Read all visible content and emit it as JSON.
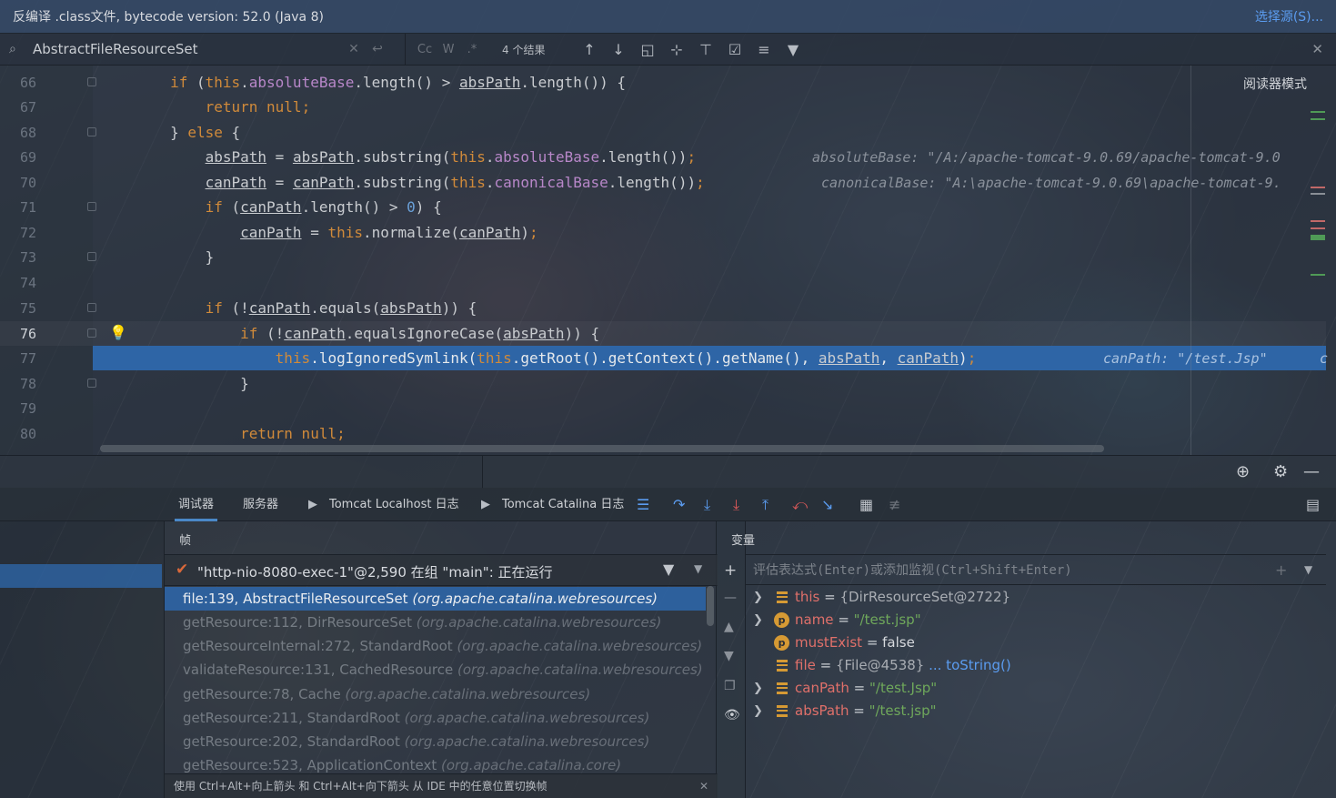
{
  "banner": {
    "text": "反编译 .class文件, bytecode version: 52.0 (Java 8)",
    "link": "选择源(S)..."
  },
  "search": {
    "query": "AbstractFileResourceSet",
    "result_count": "4 个结果",
    "btn_cc": "Cc",
    "btn_w": "W",
    "btn_regex": ".*"
  },
  "editor": {
    "reader_mode": "阅读器模式",
    "lines": [
      {
        "num": "66"
      },
      {
        "num": "67"
      },
      {
        "num": "68"
      },
      {
        "num": "69"
      },
      {
        "num": "70"
      },
      {
        "num": "71"
      },
      {
        "num": "72"
      },
      {
        "num": "73"
      },
      {
        "num": "74"
      },
      {
        "num": "75"
      },
      {
        "num": "76"
      },
      {
        "num": "77"
      },
      {
        "num": "78"
      },
      {
        "num": "79"
      },
      {
        "num": "80"
      }
    ],
    "hints": {
      "line69": "absoluteBase: \"/A:/apache-tomcat-9.0.69/apache-tomcat-9.0",
      "line70": "canonicalBase: \"A:\\apache-tomcat-9.0.69\\apache-tomcat-9.",
      "line77": "canPath: \"/test.Jsp\"",
      "line77_tail": "c"
    }
  },
  "debugger": {
    "tabs": [
      {
        "label": "调试器"
      },
      {
        "label": "服务器"
      },
      {
        "label": "Tomcat Localhost 日志"
      },
      {
        "label": "Tomcat Catalina 日志"
      }
    ],
    "frames_title": "帧",
    "thread": "\"http-nio-8080-exec-1\"@2,590 在组 \"main\": 正在运行",
    "frames": [
      {
        "loc": "file:139, AbstractFileResourceSet ",
        "cls": "(org.apache.catalina.webresources)"
      },
      {
        "loc": "getResource:112, DirResourceSet ",
        "cls": "(org.apache.catalina.webresources)"
      },
      {
        "loc": "getResourceInternal:272, StandardRoot ",
        "cls": "(org.apache.catalina.webresources)"
      },
      {
        "loc": "validateResource:131, CachedResource ",
        "cls": "(org.apache.catalina.webresources)"
      },
      {
        "loc": "getResource:78, Cache ",
        "cls": "(org.apache.catalina.webresources)"
      },
      {
        "loc": "getResource:211, StandardRoot ",
        "cls": "(org.apache.catalina.webresources)"
      },
      {
        "loc": "getResource:202, StandardRoot ",
        "cls": "(org.apache.catalina.webresources)"
      },
      {
        "loc": "getResource:523, ApplicationContext ",
        "cls": "(org.apache.catalina.core)"
      }
    ],
    "hint": "使用 Ctrl+Alt+向上箭头 和 Ctrl+Alt+向下箭头 从 IDE 中的任意位置切换帧",
    "vars_title": "变量",
    "eval_placeholder": "评估表达式(Enter)或添加监视(Ctrl+Shift+Enter)",
    "variables": [
      {
        "name": "this",
        "op": " = ",
        "value": "{DirResourceSet@2722}",
        "extra": ""
      },
      {
        "name": "name",
        "op": " = ",
        "value": "\"/test.jsp\"",
        "extra": ""
      },
      {
        "name": "mustExist",
        "op": " = ",
        "value": "false",
        "extra": ""
      },
      {
        "name": "file",
        "op": " = ",
        "value": "{File@4538}",
        "extra": " ... toString()"
      },
      {
        "name": "canPath",
        "op": " = ",
        "value": "\"/test.Jsp\"",
        "extra": ""
      },
      {
        "name": "absPath",
        "op": " = ",
        "value": "\"/test.jsp\"",
        "extra": ""
      }
    ]
  }
}
